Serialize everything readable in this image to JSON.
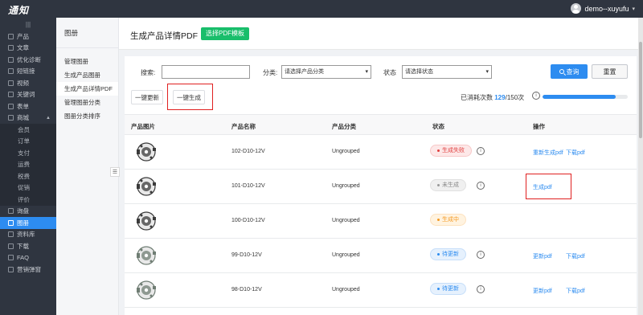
{
  "app": {
    "logo": "通知",
    "user": "demo--xuyufu"
  },
  "nav": [
    {
      "label": "产品",
      "type": "item"
    },
    {
      "label": "文章",
      "type": "item"
    },
    {
      "label": "优化诊断",
      "type": "item"
    },
    {
      "label": "短链接",
      "type": "item"
    },
    {
      "label": "视频",
      "type": "item"
    },
    {
      "label": "关键词",
      "type": "item"
    },
    {
      "label": "表单",
      "type": "item"
    },
    {
      "label": "商城",
      "type": "group"
    },
    {
      "label": "会员",
      "type": "sub"
    },
    {
      "label": "订单",
      "type": "sub"
    },
    {
      "label": "支付",
      "type": "sub"
    },
    {
      "label": "运费",
      "type": "sub"
    },
    {
      "label": "税费",
      "type": "sub"
    },
    {
      "label": "促销",
      "type": "sub"
    },
    {
      "label": "评价",
      "type": "sub"
    },
    {
      "label": "询盘",
      "type": "item"
    },
    {
      "label": "图册",
      "type": "active"
    },
    {
      "label": "资料库",
      "type": "item"
    },
    {
      "label": "下载",
      "type": "item"
    },
    {
      "label": "FAQ",
      "type": "item"
    },
    {
      "label": "营销弹窗",
      "type": "item"
    }
  ],
  "subside": {
    "title": "图册",
    "items": [
      "管理图册",
      "生成产品图册",
      "生成产品详情PDF",
      "管理图册分类",
      "图册分类排序"
    ],
    "active_index": 2
  },
  "header": {
    "title": "生成产品详情PDF",
    "template_btn": "选择PDF模板"
  },
  "filter": {
    "search_label": "搜索:",
    "search_value": "",
    "category_label": "分类:",
    "category_placeholder": "请选择产品分类",
    "status_label": "状态",
    "status_placeholder": "请选择状态",
    "search_btn": "查询",
    "reset_btn": "重置"
  },
  "actions": {
    "update_all": "一键更新",
    "generate_all": "一键生成"
  },
  "quota": {
    "prefix": "已消耗次数",
    "used": "129",
    "suffix": "/150次",
    "fraction": 0.86
  },
  "table": {
    "headers": [
      "产品图片",
      "产品名称",
      "产品分类",
      "状态",
      "操作"
    ],
    "rows": [
      {
        "name": "102-D10-12V",
        "category": "Ungrouped",
        "status": "生成失败",
        "status_type": "fail",
        "info": true,
        "ops": [
          "重新生成pdf",
          "下载pdf"
        ]
      },
      {
        "name": "101-D10-12V",
        "category": "Ungrouped",
        "status": "未生成",
        "status_type": "none",
        "info": true,
        "ops": [
          "生成pdf"
        ]
      },
      {
        "name": "100-D10-12V",
        "category": "Ungrouped",
        "status": "生成中",
        "status_type": "gen",
        "info": false,
        "ops": []
      },
      {
        "name": "99-D10-12V",
        "category": "Ungrouped",
        "status": "待更新",
        "status_type": "upd",
        "info": true,
        "ops": [
          "更新pdf",
          "下载pdf"
        ]
      },
      {
        "name": "98-D10-12V",
        "category": "Ungrouped",
        "status": "待更新",
        "status_type": "upd",
        "info": true,
        "ops": [
          "更新pdf",
          "下载pdf"
        ]
      }
    ]
  },
  "icons": {
    "info": "i",
    "collapse": "☰",
    "toggle": "|||",
    "caret": "▾"
  }
}
